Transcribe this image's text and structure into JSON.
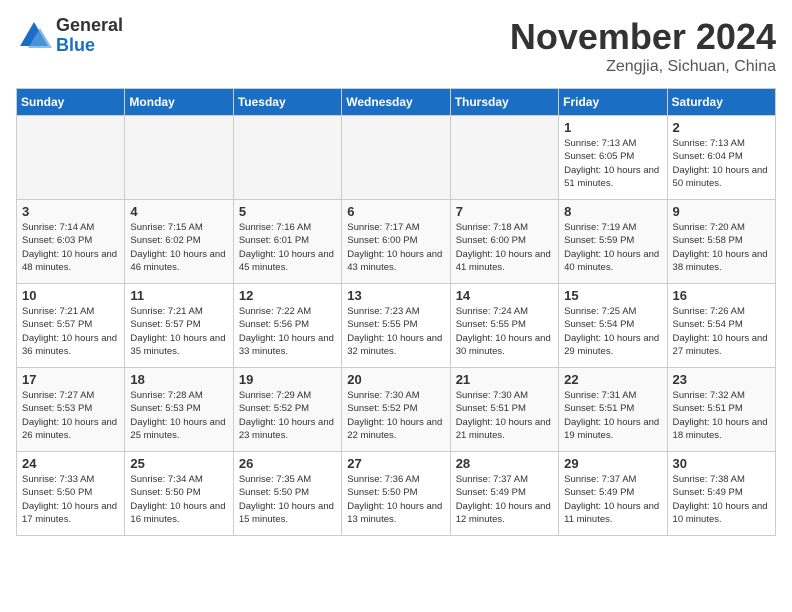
{
  "header": {
    "logo_general": "General",
    "logo_blue": "Blue",
    "month": "November 2024",
    "location": "Zengjia, Sichuan, China"
  },
  "days_of_week": [
    "Sunday",
    "Monday",
    "Tuesday",
    "Wednesday",
    "Thursday",
    "Friday",
    "Saturday"
  ],
  "weeks": [
    [
      {
        "day": "",
        "empty": true
      },
      {
        "day": "",
        "empty": true
      },
      {
        "day": "",
        "empty": true
      },
      {
        "day": "",
        "empty": true
      },
      {
        "day": "",
        "empty": true
      },
      {
        "day": "1",
        "sunrise": "Sunrise: 7:13 AM",
        "sunset": "Sunset: 6:05 PM",
        "daylight": "Daylight: 10 hours and 51 minutes."
      },
      {
        "day": "2",
        "sunrise": "Sunrise: 7:13 AM",
        "sunset": "Sunset: 6:04 PM",
        "daylight": "Daylight: 10 hours and 50 minutes."
      }
    ],
    [
      {
        "day": "3",
        "sunrise": "Sunrise: 7:14 AM",
        "sunset": "Sunset: 6:03 PM",
        "daylight": "Daylight: 10 hours and 48 minutes."
      },
      {
        "day": "4",
        "sunrise": "Sunrise: 7:15 AM",
        "sunset": "Sunset: 6:02 PM",
        "daylight": "Daylight: 10 hours and 46 minutes."
      },
      {
        "day": "5",
        "sunrise": "Sunrise: 7:16 AM",
        "sunset": "Sunset: 6:01 PM",
        "daylight": "Daylight: 10 hours and 45 minutes."
      },
      {
        "day": "6",
        "sunrise": "Sunrise: 7:17 AM",
        "sunset": "Sunset: 6:00 PM",
        "daylight": "Daylight: 10 hours and 43 minutes."
      },
      {
        "day": "7",
        "sunrise": "Sunrise: 7:18 AM",
        "sunset": "Sunset: 6:00 PM",
        "daylight": "Daylight: 10 hours and 41 minutes."
      },
      {
        "day": "8",
        "sunrise": "Sunrise: 7:19 AM",
        "sunset": "Sunset: 5:59 PM",
        "daylight": "Daylight: 10 hours and 40 minutes."
      },
      {
        "day": "9",
        "sunrise": "Sunrise: 7:20 AM",
        "sunset": "Sunset: 5:58 PM",
        "daylight": "Daylight: 10 hours and 38 minutes."
      }
    ],
    [
      {
        "day": "10",
        "sunrise": "Sunrise: 7:21 AM",
        "sunset": "Sunset: 5:57 PM",
        "daylight": "Daylight: 10 hours and 36 minutes."
      },
      {
        "day": "11",
        "sunrise": "Sunrise: 7:21 AM",
        "sunset": "Sunset: 5:57 PM",
        "daylight": "Daylight: 10 hours and 35 minutes."
      },
      {
        "day": "12",
        "sunrise": "Sunrise: 7:22 AM",
        "sunset": "Sunset: 5:56 PM",
        "daylight": "Daylight: 10 hours and 33 minutes."
      },
      {
        "day": "13",
        "sunrise": "Sunrise: 7:23 AM",
        "sunset": "Sunset: 5:55 PM",
        "daylight": "Daylight: 10 hours and 32 minutes."
      },
      {
        "day": "14",
        "sunrise": "Sunrise: 7:24 AM",
        "sunset": "Sunset: 5:55 PM",
        "daylight": "Daylight: 10 hours and 30 minutes."
      },
      {
        "day": "15",
        "sunrise": "Sunrise: 7:25 AM",
        "sunset": "Sunset: 5:54 PM",
        "daylight": "Daylight: 10 hours and 29 minutes."
      },
      {
        "day": "16",
        "sunrise": "Sunrise: 7:26 AM",
        "sunset": "Sunset: 5:54 PM",
        "daylight": "Daylight: 10 hours and 27 minutes."
      }
    ],
    [
      {
        "day": "17",
        "sunrise": "Sunrise: 7:27 AM",
        "sunset": "Sunset: 5:53 PM",
        "daylight": "Daylight: 10 hours and 26 minutes."
      },
      {
        "day": "18",
        "sunrise": "Sunrise: 7:28 AM",
        "sunset": "Sunset: 5:53 PM",
        "daylight": "Daylight: 10 hours and 25 minutes."
      },
      {
        "day": "19",
        "sunrise": "Sunrise: 7:29 AM",
        "sunset": "Sunset: 5:52 PM",
        "daylight": "Daylight: 10 hours and 23 minutes."
      },
      {
        "day": "20",
        "sunrise": "Sunrise: 7:30 AM",
        "sunset": "Sunset: 5:52 PM",
        "daylight": "Daylight: 10 hours and 22 minutes."
      },
      {
        "day": "21",
        "sunrise": "Sunrise: 7:30 AM",
        "sunset": "Sunset: 5:51 PM",
        "daylight": "Daylight: 10 hours and 21 minutes."
      },
      {
        "day": "22",
        "sunrise": "Sunrise: 7:31 AM",
        "sunset": "Sunset: 5:51 PM",
        "daylight": "Daylight: 10 hours and 19 minutes."
      },
      {
        "day": "23",
        "sunrise": "Sunrise: 7:32 AM",
        "sunset": "Sunset: 5:51 PM",
        "daylight": "Daylight: 10 hours and 18 minutes."
      }
    ],
    [
      {
        "day": "24",
        "sunrise": "Sunrise: 7:33 AM",
        "sunset": "Sunset: 5:50 PM",
        "daylight": "Daylight: 10 hours and 17 minutes."
      },
      {
        "day": "25",
        "sunrise": "Sunrise: 7:34 AM",
        "sunset": "Sunset: 5:50 PM",
        "daylight": "Daylight: 10 hours and 16 minutes."
      },
      {
        "day": "26",
        "sunrise": "Sunrise: 7:35 AM",
        "sunset": "Sunset: 5:50 PM",
        "daylight": "Daylight: 10 hours and 15 minutes."
      },
      {
        "day": "27",
        "sunrise": "Sunrise: 7:36 AM",
        "sunset": "Sunset: 5:50 PM",
        "daylight": "Daylight: 10 hours and 13 minutes."
      },
      {
        "day": "28",
        "sunrise": "Sunrise: 7:37 AM",
        "sunset": "Sunset: 5:49 PM",
        "daylight": "Daylight: 10 hours and 12 minutes."
      },
      {
        "day": "29",
        "sunrise": "Sunrise: 7:37 AM",
        "sunset": "Sunset: 5:49 PM",
        "daylight": "Daylight: 10 hours and 11 minutes."
      },
      {
        "day": "30",
        "sunrise": "Sunrise: 7:38 AM",
        "sunset": "Sunset: 5:49 PM",
        "daylight": "Daylight: 10 hours and 10 minutes."
      }
    ]
  ]
}
